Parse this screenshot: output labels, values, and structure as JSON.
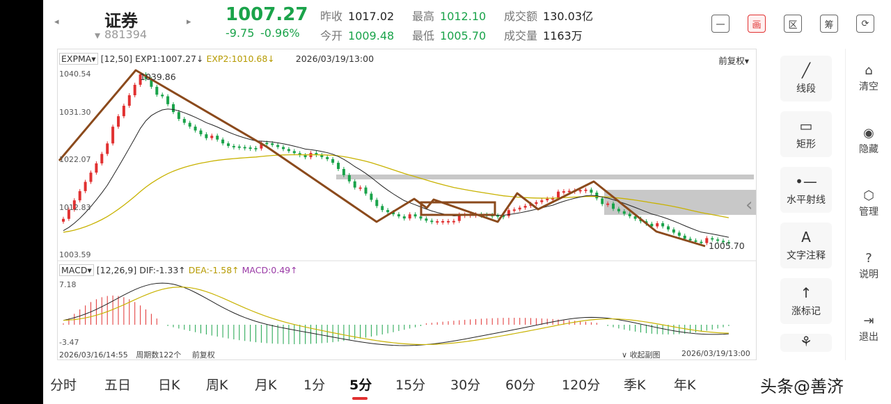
{
  "header": {
    "prev_arrow": "◂",
    "next_arrow": "▸",
    "name": "证券",
    "code": "881394",
    "code_caret": "▾",
    "price": "1007.27",
    "change": "-9.75",
    "change_pct": "-0.96%",
    "stats": [
      {
        "label": "昨收",
        "value": "1017.02",
        "color": "#222222"
      },
      {
        "label": "最高",
        "value": "1012.10",
        "color": "#1aa34a"
      },
      {
        "label": "成交额",
        "value": "130.03亿",
        "color": "#222222"
      },
      {
        "label": "今开",
        "value": "1009.48",
        "color": "#1aa34a"
      },
      {
        "label": "最低",
        "value": "1005.70",
        "color": "#1aa34a"
      },
      {
        "label": "成交量",
        "value": "1163万",
        "color": "#222222"
      }
    ],
    "toolbar": [
      {
        "name": "minimize-icon",
        "label": "一",
        "active": false
      },
      {
        "name": "draw-icon",
        "label": "画",
        "active": true
      },
      {
        "name": "zone-icon",
        "label": "区",
        "active": false
      },
      {
        "name": "chips-icon",
        "label": "筹",
        "active": false
      },
      {
        "name": "rotate-icon",
        "label": "⟳",
        "active": false
      }
    ]
  },
  "chart": {
    "main_indicator": "EXPMA",
    "main_params": "[12,50]",
    "exp1": "EXP1:1007.27↓",
    "exp2": "EXP2:1010.68↓",
    "datetime": "2026/03/19/13:00",
    "adjust": "前复权",
    "y_labels": [
      "1040.54",
      "1031.30",
      "1022.07",
      "1012.83",
      "1003.59"
    ],
    "high_label": "1039.86",
    "low_label": "1005.70",
    "sub_indicator": "MACD",
    "sub_params": "[12,26,9]",
    "dif": "DIF:-1.33↑",
    "dea": "DEA:-1.58↑",
    "macd": "MACD:0.49↑",
    "macd_y_labels": [
      "7.18",
      "-3.47"
    ],
    "footer_start": "2026/03/16/14:55",
    "footer_period": "周期数122个",
    "footer_adjust": "前复权",
    "footer_collapse": "收起副图",
    "footer_end": "2026/03/19/13:00",
    "colors": {
      "up": "#e13131",
      "down": "#1aa34a",
      "exp1": "#222222",
      "exp2": "#c8b200",
      "trend": "#8b4a1c",
      "zone": "#c8c8c8"
    }
  },
  "tools": [
    {
      "name": "segment-tool",
      "icon": "╱",
      "label": "线段"
    },
    {
      "name": "rectangle-tool",
      "icon": "▭",
      "label": "矩形"
    },
    {
      "name": "horizontal-ray-tool",
      "icon": "•—",
      "label": "水平射线"
    },
    {
      "name": "text-annotation-tool",
      "icon": "A",
      "label": "文字注释"
    },
    {
      "name": "rise-mark-tool",
      "icon": "↑",
      "label": "涨标记"
    },
    {
      "name": "more-tool",
      "icon": "⚘",
      "label": ""
    }
  ],
  "collapse_arrow": "‹",
  "side": [
    {
      "name": "clear",
      "icon": "⌂",
      "label": "清空"
    },
    {
      "name": "hide",
      "icon": "◉",
      "label": "隐藏"
    },
    {
      "name": "manage",
      "icon": "⬡",
      "label": "管理"
    },
    {
      "name": "help",
      "icon": "?",
      "label": "说明"
    },
    {
      "name": "exit",
      "icon": "⇥",
      "label": "退出"
    }
  ],
  "tabs": [
    {
      "label": "分时",
      "active": false
    },
    {
      "label": "五日",
      "active": false
    },
    {
      "label": "日K",
      "active": false
    },
    {
      "label": "周K",
      "active": false
    },
    {
      "label": "月K",
      "active": false
    },
    {
      "label": "1分",
      "active": false
    },
    {
      "label": "5分",
      "active": true
    },
    {
      "label": "15分",
      "active": false
    },
    {
      "label": "30分",
      "active": false
    },
    {
      "label": "60分",
      "active": false
    },
    {
      "label": "120分",
      "active": false
    },
    {
      "label": "季K",
      "active": false
    },
    {
      "label": "年K",
      "active": false
    }
  ],
  "watermark": "头条@善济"
}
